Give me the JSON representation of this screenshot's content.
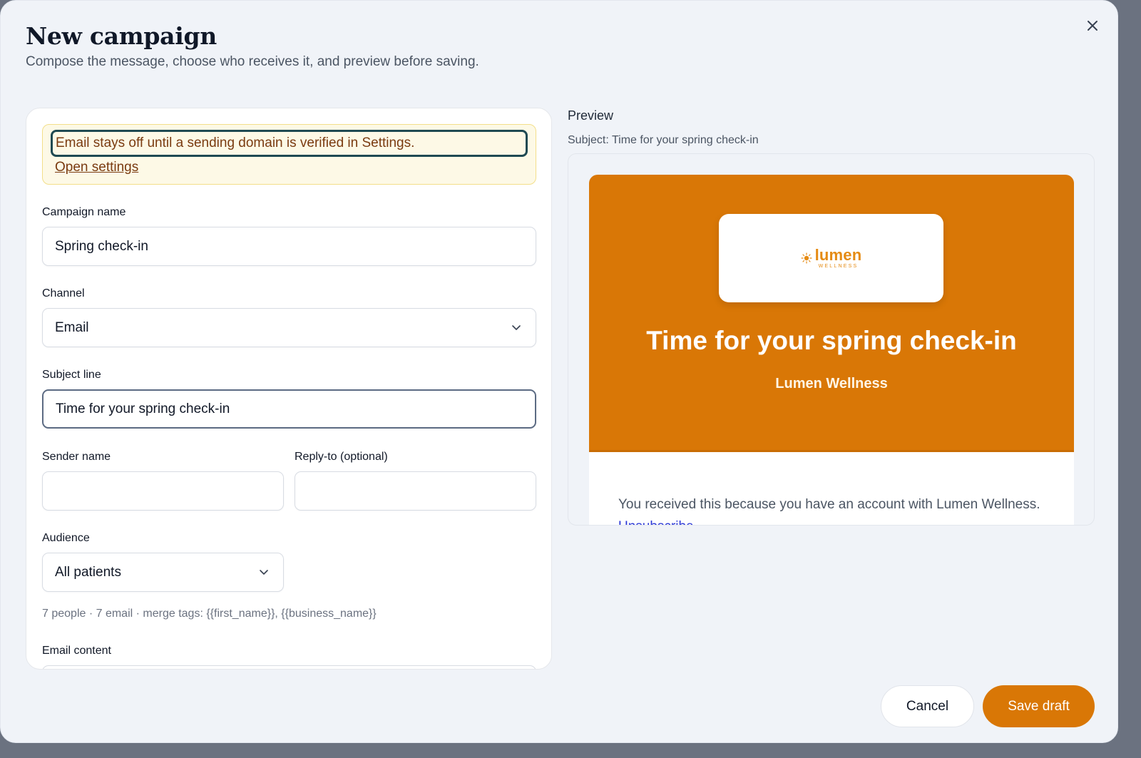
{
  "dialog": {
    "title": "New campaign",
    "subtitle": "Compose the message, choose who receives it, and preview before saving."
  },
  "alert": {
    "message": "Email stays off until a sending domain is verified in Settings.",
    "link": "Open settings"
  },
  "form": {
    "campaign_name": {
      "label": "Campaign name",
      "value": "Spring check-in"
    },
    "channel": {
      "label": "Channel",
      "value": "Email"
    },
    "subject": {
      "label": "Subject line",
      "value": "Time for your spring check-in"
    },
    "sender": {
      "label": "Sender name",
      "value": ""
    },
    "reply_to": {
      "label": "Reply-to (optional)",
      "value": ""
    },
    "audience": {
      "label": "Audience",
      "value": "All patients",
      "hint": "7 people · 7 email · merge tags: {{first_name}}, {{business_name}}"
    },
    "content": {
      "label": "Email content"
    }
  },
  "preview": {
    "title": "Preview",
    "subject_line": "Subject: Time for your spring check-in",
    "logo_word": "lumen",
    "logo_sub": "WELLNESS",
    "hero_title": "Time for your spring check-in",
    "brand": "Lumen Wellness",
    "footer_text": "You received this because you have an account with Lumen Wellness.",
    "unsubscribe": "Unsubscribe"
  },
  "actions": {
    "cancel": "Cancel",
    "save": "Save draft"
  },
  "colors": {
    "accent": "#d97706",
    "background": "#f0f3f8",
    "alert_bg": "#fdf9e6"
  },
  "icons": {
    "close": "close-icon",
    "dropdown": "chevron-down-icon",
    "logo": "sun-icon"
  }
}
